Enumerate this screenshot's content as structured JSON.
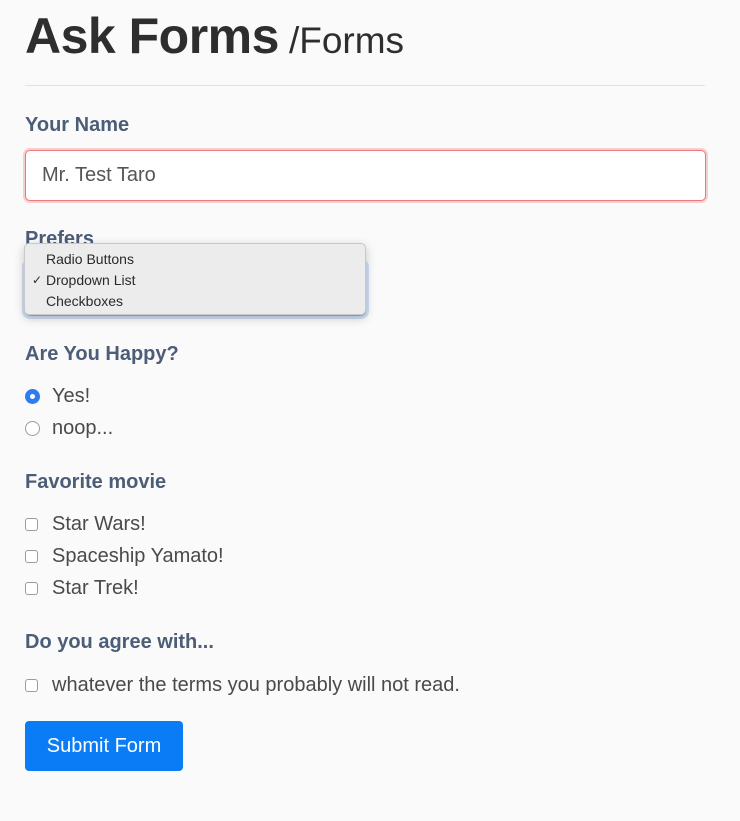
{
  "header": {
    "title": "Ask Forms",
    "subtitle": "/Forms"
  },
  "name_field": {
    "label": "Your Name",
    "value": "Mr. Test Taro"
  },
  "prefers": {
    "label": "Prefers",
    "options": [
      "Radio Buttons",
      "Dropdown List",
      "Checkboxes"
    ],
    "selected": "Dropdown List",
    "check_glyph": "✓"
  },
  "happy": {
    "label": "Are You Happy?",
    "options": [
      {
        "label": "Yes!",
        "checked": true
      },
      {
        "label": "noop...",
        "checked": false
      }
    ]
  },
  "movies": {
    "label": "Favorite movie",
    "options": [
      {
        "label": "Star Wars!",
        "checked": false
      },
      {
        "label": "Spaceship Yamato!",
        "checked": false
      },
      {
        "label": "Star Trek!",
        "checked": false
      }
    ]
  },
  "agree": {
    "label": "Do you agree with...",
    "option": {
      "label": "whatever the terms you probably will not read.",
      "checked": false
    }
  },
  "submit": {
    "label": "Submit Form"
  },
  "colors": {
    "label": "#4b5d77",
    "accent": "#0a7cf6",
    "invalid_border": "#ea7a7a",
    "focus_border": "#8fb6ea"
  }
}
